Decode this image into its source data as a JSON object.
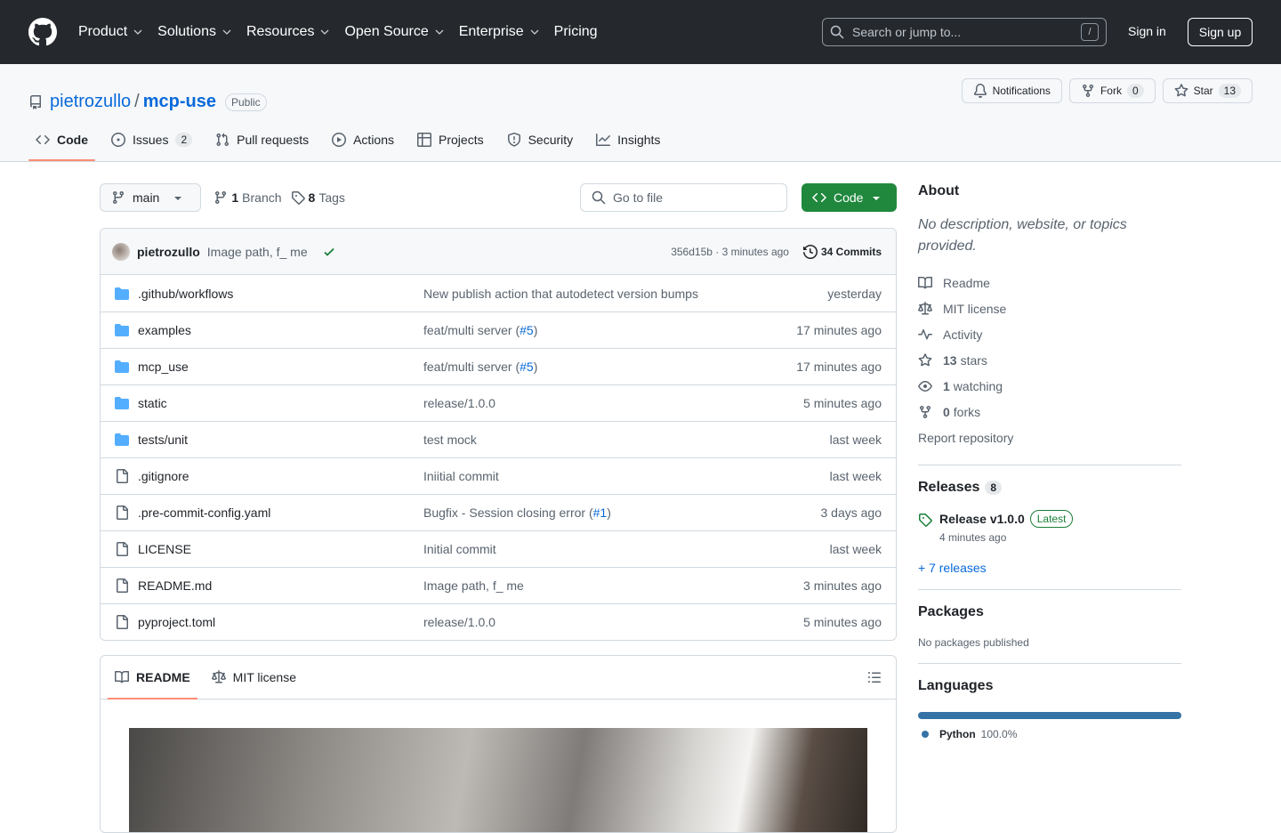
{
  "header": {
    "nav": [
      {
        "label": "Product"
      },
      {
        "label": "Solutions"
      },
      {
        "label": "Resources"
      },
      {
        "label": "Open Source"
      },
      {
        "label": "Enterprise"
      },
      {
        "label": "Pricing"
      }
    ],
    "search_placeholder": "Search or jump to...",
    "search_shortcut": "/",
    "signin": "Sign in",
    "signup": "Sign up"
  },
  "repo": {
    "owner": "pietrozullo",
    "separator": "/",
    "name": "mcp-use",
    "visibility": "Public",
    "notifications_label": "Notifications",
    "fork_label": "Fork",
    "fork_count": "0",
    "star_label": "Star",
    "star_count": "13"
  },
  "tabs": [
    {
      "label": "Code",
      "icon": "code-icon",
      "active": true
    },
    {
      "label": "Issues",
      "icon": "issue-icon",
      "count": "2"
    },
    {
      "label": "Pull requests",
      "icon": "pull-request-icon"
    },
    {
      "label": "Actions",
      "icon": "play-icon"
    },
    {
      "label": "Projects",
      "icon": "table-icon"
    },
    {
      "label": "Security",
      "icon": "shield-icon"
    },
    {
      "label": "Insights",
      "icon": "graph-icon"
    }
  ],
  "toolbar": {
    "branch": "main",
    "branch_count": "1",
    "branch_label": "Branch",
    "tag_count": "8",
    "tag_label": "Tags",
    "goto_placeholder": "Go to file",
    "code_button": "Code"
  },
  "commit": {
    "user": "pietrozullo",
    "message": "Image path, f_ me",
    "sha_time": "356d15b · 3 minutes ago",
    "commits": "34 Commits"
  },
  "files": [
    {
      "type": "dir",
      "name": ".github/workflows",
      "msg": "New publish action that autodetect version bumps",
      "pr": "",
      "age": "yesterday"
    },
    {
      "type": "dir",
      "name": "examples",
      "msg": "feat/multi server (",
      "pr": "#5",
      "msg_end": ")",
      "age": "17 minutes ago"
    },
    {
      "type": "dir",
      "name": "mcp_use",
      "msg": "feat/multi server (",
      "pr": "#5",
      "msg_end": ")",
      "age": "17 minutes ago"
    },
    {
      "type": "dir",
      "name": "static",
      "msg": "release/1.0.0",
      "pr": "",
      "age": "5 minutes ago"
    },
    {
      "type": "dir",
      "name": "tests/unit",
      "msg": "test mock",
      "pr": "",
      "age": "last week"
    },
    {
      "type": "file",
      "name": ".gitignore",
      "msg": "Iniitial commit",
      "pr": "",
      "age": "last week"
    },
    {
      "type": "file",
      "name": ".pre-commit-config.yaml",
      "msg": "Bugfix - Session closing error (",
      "pr": "#1",
      "msg_end": ")",
      "age": "3 days ago"
    },
    {
      "type": "file",
      "name": "LICENSE",
      "msg": "Initial commit",
      "pr": "",
      "age": "last week"
    },
    {
      "type": "file",
      "name": "README.md",
      "msg": "Image path, f_ me",
      "pr": "",
      "age": "3 minutes ago"
    },
    {
      "type": "file",
      "name": "pyproject.toml",
      "msg": "release/1.0.0",
      "pr": "",
      "age": "5 minutes ago"
    }
  ],
  "readme": {
    "tab_readme": "README",
    "tab_license": "MIT license"
  },
  "about": {
    "title": "About",
    "description": "No description, website, or topics provided.",
    "readme": "Readme",
    "license": "MIT license",
    "activity": "Activity",
    "stars_count": "13",
    "stars_label": "stars",
    "watching_count": "1",
    "watching_label": "watching",
    "forks_count": "0",
    "forks_label": "forks",
    "report": "Report repository"
  },
  "releases": {
    "title": "Releases",
    "count": "8",
    "latest_name": "Release v1.0.0",
    "latest_badge": "Latest",
    "latest_time": "4 minutes ago",
    "more": "+ 7 releases"
  },
  "packages": {
    "title": "Packages",
    "none": "No packages published"
  },
  "languages": {
    "title": "Languages",
    "items": [
      {
        "name": "Python",
        "percent": "100.0%",
        "color": "#3572A5"
      }
    ]
  }
}
